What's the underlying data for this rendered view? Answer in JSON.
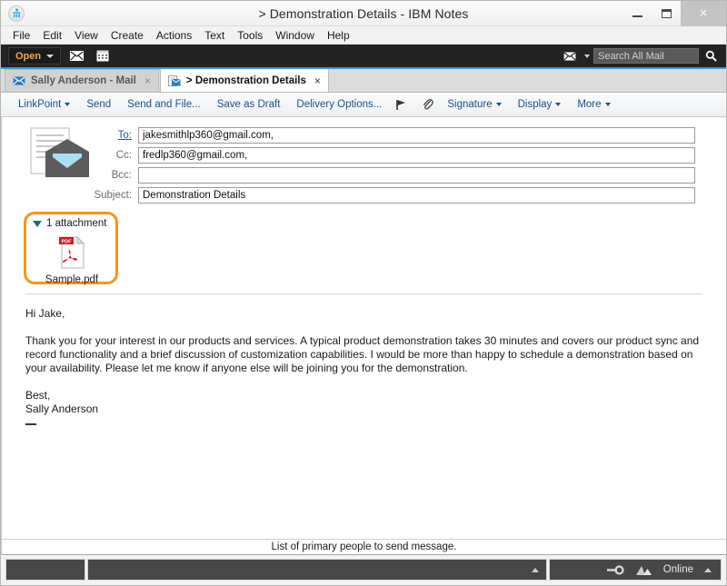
{
  "window": {
    "title": "> Demonstration Details - IBM Notes",
    "logo_icon": "ibm-notes-logo-icon",
    "minimize_label": "minimize-icon",
    "maximize_label": "maximize-icon",
    "close_label": "×"
  },
  "menubar": {
    "items": [
      {
        "label": "File"
      },
      {
        "label": "Edit"
      },
      {
        "label": "View"
      },
      {
        "label": "Create"
      },
      {
        "label": "Actions"
      },
      {
        "label": "Text"
      },
      {
        "label": "Tools"
      },
      {
        "label": "Window"
      },
      {
        "label": "Help"
      }
    ]
  },
  "toolbar": {
    "open_label": "Open",
    "mail_icon": "envelope-icon",
    "calendar_icon": "calendar-icon",
    "search": {
      "scope_icon": "envelope-icon",
      "placeholder": "Search All Mail",
      "value": "",
      "submit_icon": "magnifier-icon"
    }
  },
  "tabs": [
    {
      "label": "Sally Anderson - Mail",
      "icon": "envelope-icon",
      "close": "×",
      "active": false
    },
    {
      "label": "> Demonstration Details",
      "icon": "memo-envelope-icon",
      "close": "×",
      "active": true
    }
  ],
  "actionbar": {
    "items": [
      {
        "label": "LinkPoint",
        "caret": true
      },
      {
        "label": "Send",
        "caret": false
      },
      {
        "label": "Send and File...",
        "caret": false
      },
      {
        "label": "Save as Draft",
        "caret": false
      },
      {
        "label": "Delivery Options...",
        "caret": false
      }
    ],
    "flag_icon": "flag-icon",
    "attach_icon": "paperclip-icon",
    "menus": [
      {
        "label": "Signature"
      },
      {
        "label": "Display"
      },
      {
        "label": "More"
      }
    ]
  },
  "memo": {
    "icon": "memo-envelope-icon",
    "fields": [
      {
        "label": "To:",
        "value": "jakesmithlp360@gmail.com,",
        "name": "to"
      },
      {
        "label": "Cc:",
        "value": "fredlp360@gmail.com,",
        "name": "cc"
      },
      {
        "label": "Bcc:",
        "value": "",
        "name": "bcc"
      },
      {
        "label": "Subject:",
        "value": "Demonstration Details",
        "name": "subject"
      }
    ],
    "attachments": {
      "header": "1 attachment",
      "highlight_color": "#f7941e",
      "items": [
        {
          "filename": "Sample.pdf",
          "icon": "pdf-file-icon",
          "badge": "PDF"
        }
      ]
    },
    "body": {
      "greeting": "Hi Jake,",
      "paragraph": "Thank you for your interest in our products and services. A typical product demonstration takes 30 minutes and covers our product sync and record functionality and a brief discussion of customization capabilities. I would be more than happy to schedule a demonstration based on your availability. Please let me know if anyone else will be joining you for the demonstration.",
      "closing": "Best,",
      "sender": "Sally Anderson"
    }
  },
  "statusbar": {
    "hint": "List of primary people to send message.",
    "key_icon": "key-icon",
    "location_icon": "location-icon",
    "online_label": "Online"
  }
}
